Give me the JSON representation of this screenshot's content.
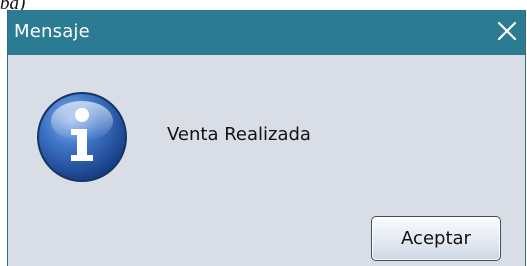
{
  "window": {
    "title": "Mensaje",
    "close_icon": "close-icon"
  },
  "dialog": {
    "icon": "info-icon",
    "message": "Venta Realizada",
    "ok_label": "Aceptar"
  },
  "colors": {
    "titlebar": "#2b7b93",
    "body": "#d8dde6",
    "icon_blue": "#2f5fae"
  }
}
